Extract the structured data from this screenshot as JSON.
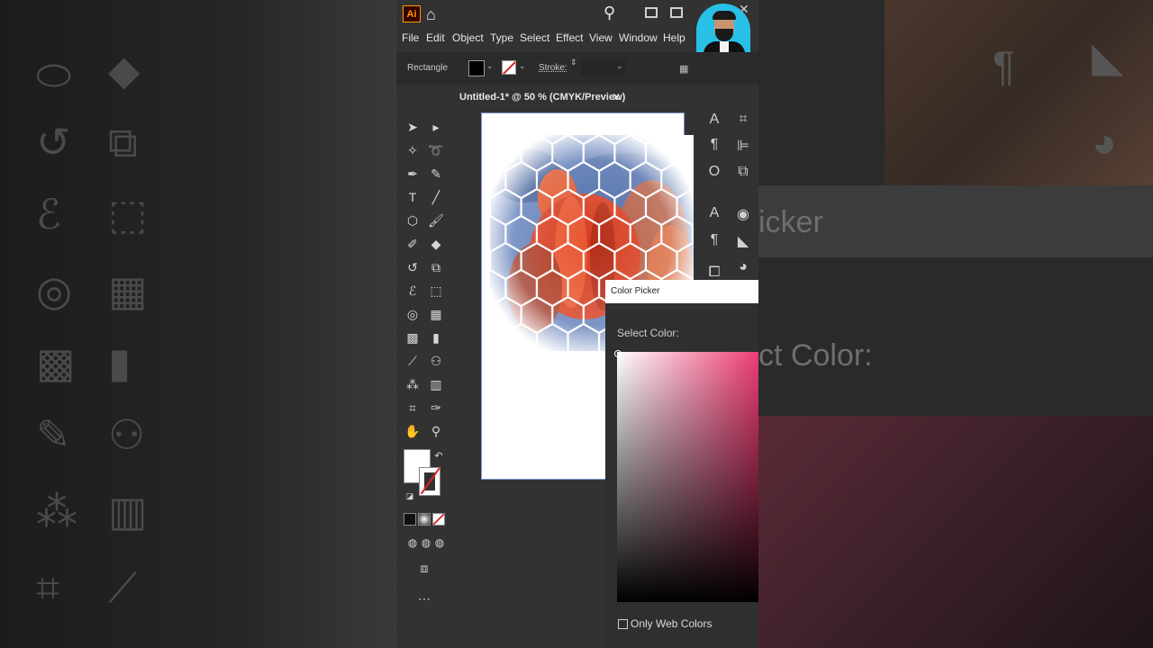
{
  "app": {
    "logo": "Ai",
    "menu": [
      "File",
      "Edit",
      "Object",
      "Type",
      "Select",
      "Effect",
      "View",
      "Window",
      "Help"
    ]
  },
  "control_bar": {
    "object_type": "Rectangle",
    "stroke_label": "Stroke:"
  },
  "document": {
    "tab_title": "Untitled-1* @ 50 % (CMYK/Preview)"
  },
  "color_picker": {
    "title": "Color Picker",
    "select_label": "Select Color:",
    "only_web_colors": "Only Web Colors",
    "gradient_color": "#ee3d74"
  },
  "background": {
    "right_text_1": "icker",
    "right_text_2": "ct Color:"
  }
}
